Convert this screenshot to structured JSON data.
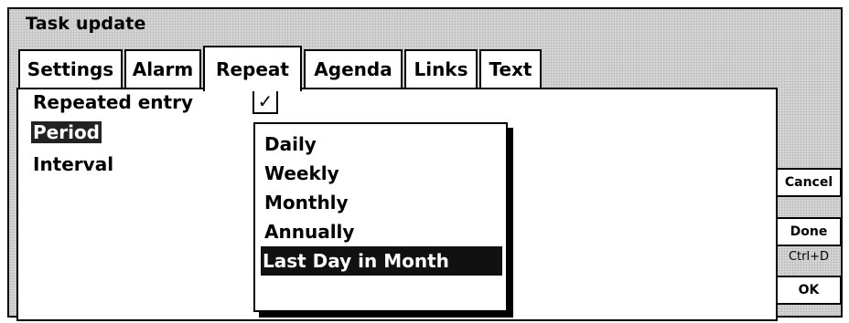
{
  "window": {
    "title": "Task update"
  },
  "tabs": [
    {
      "label": "Settings",
      "active": false
    },
    {
      "label": "Alarm",
      "active": false
    },
    {
      "label": "Repeat",
      "active": true
    },
    {
      "label": "Agenda",
      "active": false
    },
    {
      "label": "Links",
      "active": false
    },
    {
      "label": "Text",
      "active": false
    }
  ],
  "form": {
    "repeated_entry_label": "Repeated entry",
    "repeated_entry_checked": true,
    "repeated_entry_mark": "✓",
    "period_label": "Period",
    "interval_label": "Interval"
  },
  "period_dropdown": {
    "options": [
      "Daily",
      "Weekly",
      "Monthly",
      "Annually",
      "Last Day in Month"
    ],
    "selected": "Last Day in Month"
  },
  "buttons": {
    "cancel": "Cancel",
    "done": "Done",
    "done_shortcut": "Ctrl+D",
    "ok": "OK"
  }
}
